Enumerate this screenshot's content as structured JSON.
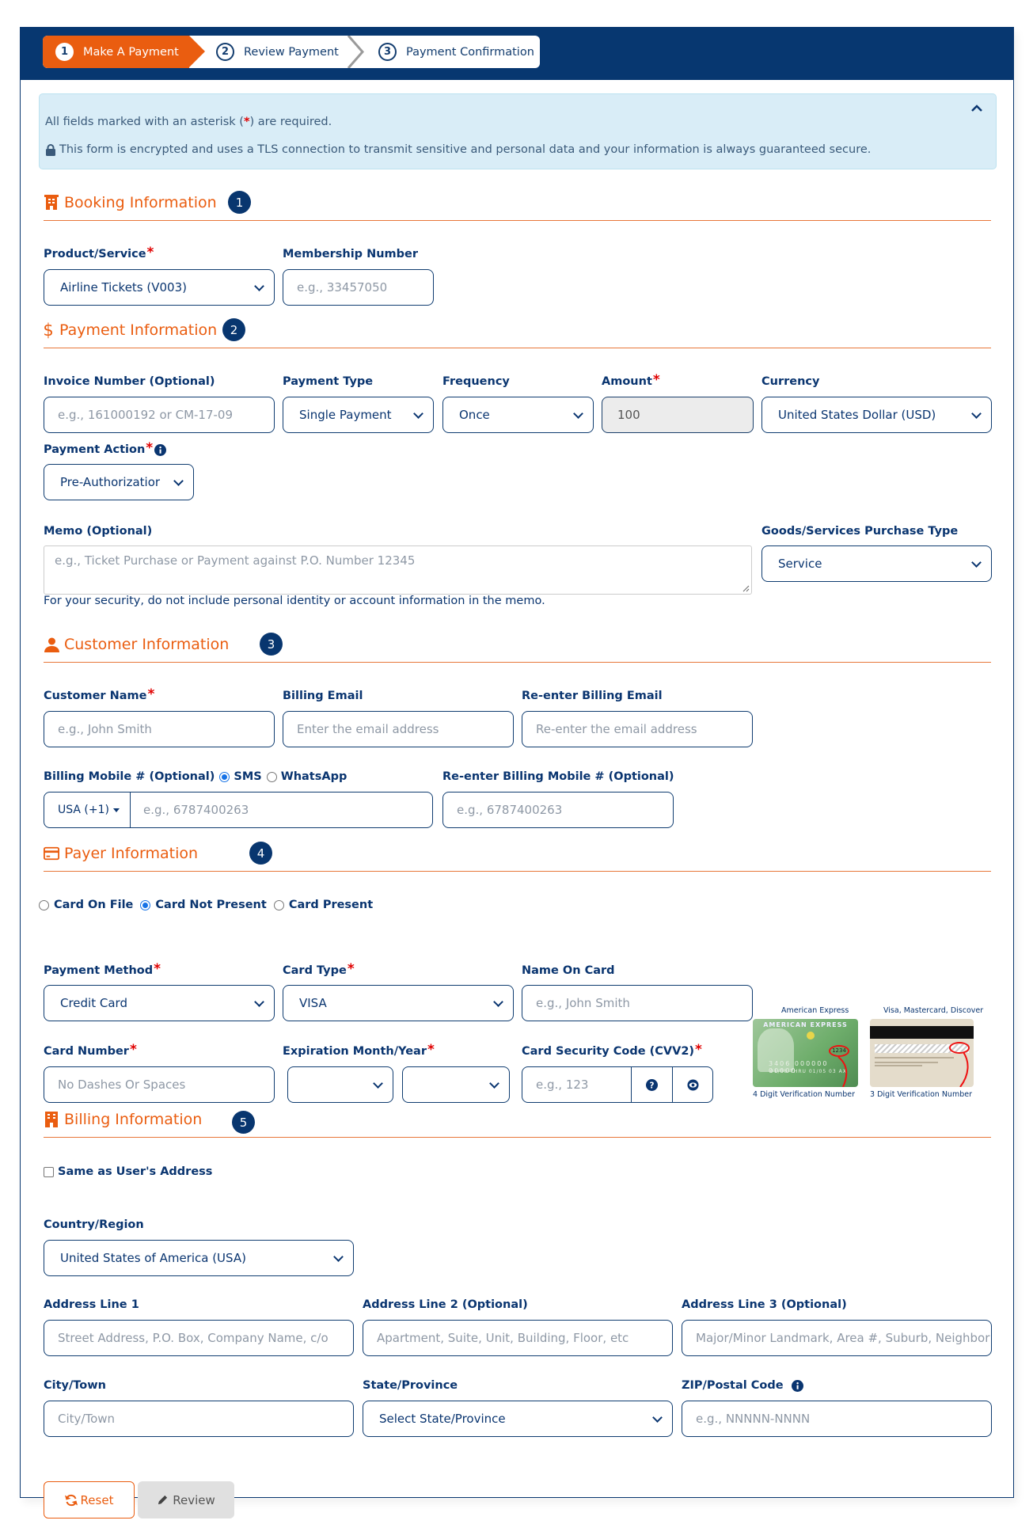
{
  "stepper": {
    "steps": [
      {
        "num": "1",
        "label": "Make A Payment",
        "state": "active"
      },
      {
        "num": "2",
        "label": "Review Payment",
        "state": "upcoming"
      },
      {
        "num": "3",
        "label": "Payment Confirmation",
        "state": "upcoming"
      }
    ]
  },
  "notice": {
    "line1_pre": "All fields marked with an asterisk (",
    "line1_star": "*",
    "line1_post": ") are required.",
    "line2": "This form is encrypted and uses a TLS connection to transmit sensitive and personal data and your information is always guaranteed secure."
  },
  "sections": {
    "booking": {
      "title": "Booking Information",
      "badge": "1"
    },
    "payment": {
      "title": "Payment Information",
      "badge": "2",
      "icon_glyph": "$"
    },
    "customer": {
      "title": "Customer Information",
      "badge": "3"
    },
    "payer": {
      "title": "Payer Information",
      "badge": "4"
    },
    "billing": {
      "title": "Billing Information",
      "badge": "5"
    }
  },
  "required_mark": "*",
  "booking": {
    "product_label": "Product/Service",
    "product_value": "Airline Tickets (V003)",
    "membership_label": "Membership Number",
    "membership_placeholder": "e.g., 33457050"
  },
  "payment": {
    "invoice_label": "Invoice Number (Optional)",
    "invoice_placeholder": "e.g., 161000192 or CM-17-09",
    "type_label": "Payment Type",
    "type_value": "Single Payment",
    "frequency_label": "Frequency",
    "frequency_value": "Once",
    "amount_label": "Amount",
    "amount_value": "100",
    "currency_label": "Currency",
    "currency_value": "United States Dollar (USD)",
    "action_label": "Payment Action",
    "action_value": "Pre-Authorizatior",
    "memo_label": "Memo (Optional)",
    "memo_placeholder": "e.g., Ticket Purchase or Payment against P.O. Number 12345",
    "memo_help": "For your security, do not include personal identity or account information in the memo.",
    "purchase_type_label": "Goods/Services Purchase Type",
    "purchase_type_value": "Service"
  },
  "customer": {
    "name_label": "Customer Name",
    "name_placeholder": "e.g., John Smith",
    "email_label": "Billing Email",
    "email_placeholder": "Enter the email address",
    "reemail_label": "Re-enter Billing Email",
    "reemail_placeholder": "Re-enter the email address",
    "mobile_label": "Billing Mobile # (Optional)",
    "sms_label": "SMS",
    "whatsapp_label": "WhatsApp",
    "country_code": "USA (+1)",
    "mobile_placeholder": "e.g., 6787400263",
    "remobile_label": "Re-enter Billing Mobile # (Optional)",
    "remobile_placeholder": "e.g., 6787400263"
  },
  "payer": {
    "card_modes": [
      {
        "label": "Card On File",
        "selected": false
      },
      {
        "label": "Card Not Present",
        "selected": true
      },
      {
        "label": "Card Present",
        "selected": false
      }
    ],
    "method_label": "Payment Method",
    "method_value": "Credit Card",
    "card_type_label": "Card Type",
    "card_type_value": "VISA",
    "name_on_card_label": "Name On Card",
    "name_on_card_placeholder": "e.g., John Smith",
    "card_number_label": "Card Number",
    "card_number_placeholder": "No Dashes Or Spaces",
    "expiry_label": "Expiration Month/Year",
    "expiry_month_value": "",
    "expiry_year_value": "",
    "cvv_label": "Card Security Code (CVV2)",
    "cvv_placeholder": "e.g., 123",
    "amex_caption_top": "American Express",
    "amex_caption_bottom": "4 Digit Verification Number",
    "amex_sample_digits": "1234",
    "visa_caption_top": "Visa, Mastercard, Discover",
    "visa_caption_bottom": "3 Digit Verification Number"
  },
  "billing": {
    "same_address_label": "Same as User's Address",
    "same_address_checked": false,
    "country_label": "Country/Region",
    "country_value": "United States of America (USA)",
    "addr1_label": "Address Line 1",
    "addr1_placeholder": "Street Address, P.O. Box, Company Name, c/o",
    "addr2_label": "Address Line 2 (Optional)",
    "addr2_placeholder": "Apartment, Suite, Unit, Building, Floor, etc",
    "addr3_label": "Address Line 3 (Optional)",
    "addr3_placeholder": "Major/Minor Landmark, Area #, Suburb, Neighbor",
    "city_label": "City/Town",
    "city_placeholder": "City/Town",
    "state_label": "State/Province",
    "state_value": "Select State/Province",
    "zip_label": "ZIP/Postal Code",
    "zip_placeholder": "e.g., NNNNN-NNNN"
  },
  "actions": {
    "reset_label": "Reset",
    "review_label": "Review"
  },
  "colors": {
    "brand_navy": "#073770",
    "accent_orange": "#ea5d10",
    "notice_bg": "#d9edf7",
    "required_red": "#e00000"
  }
}
